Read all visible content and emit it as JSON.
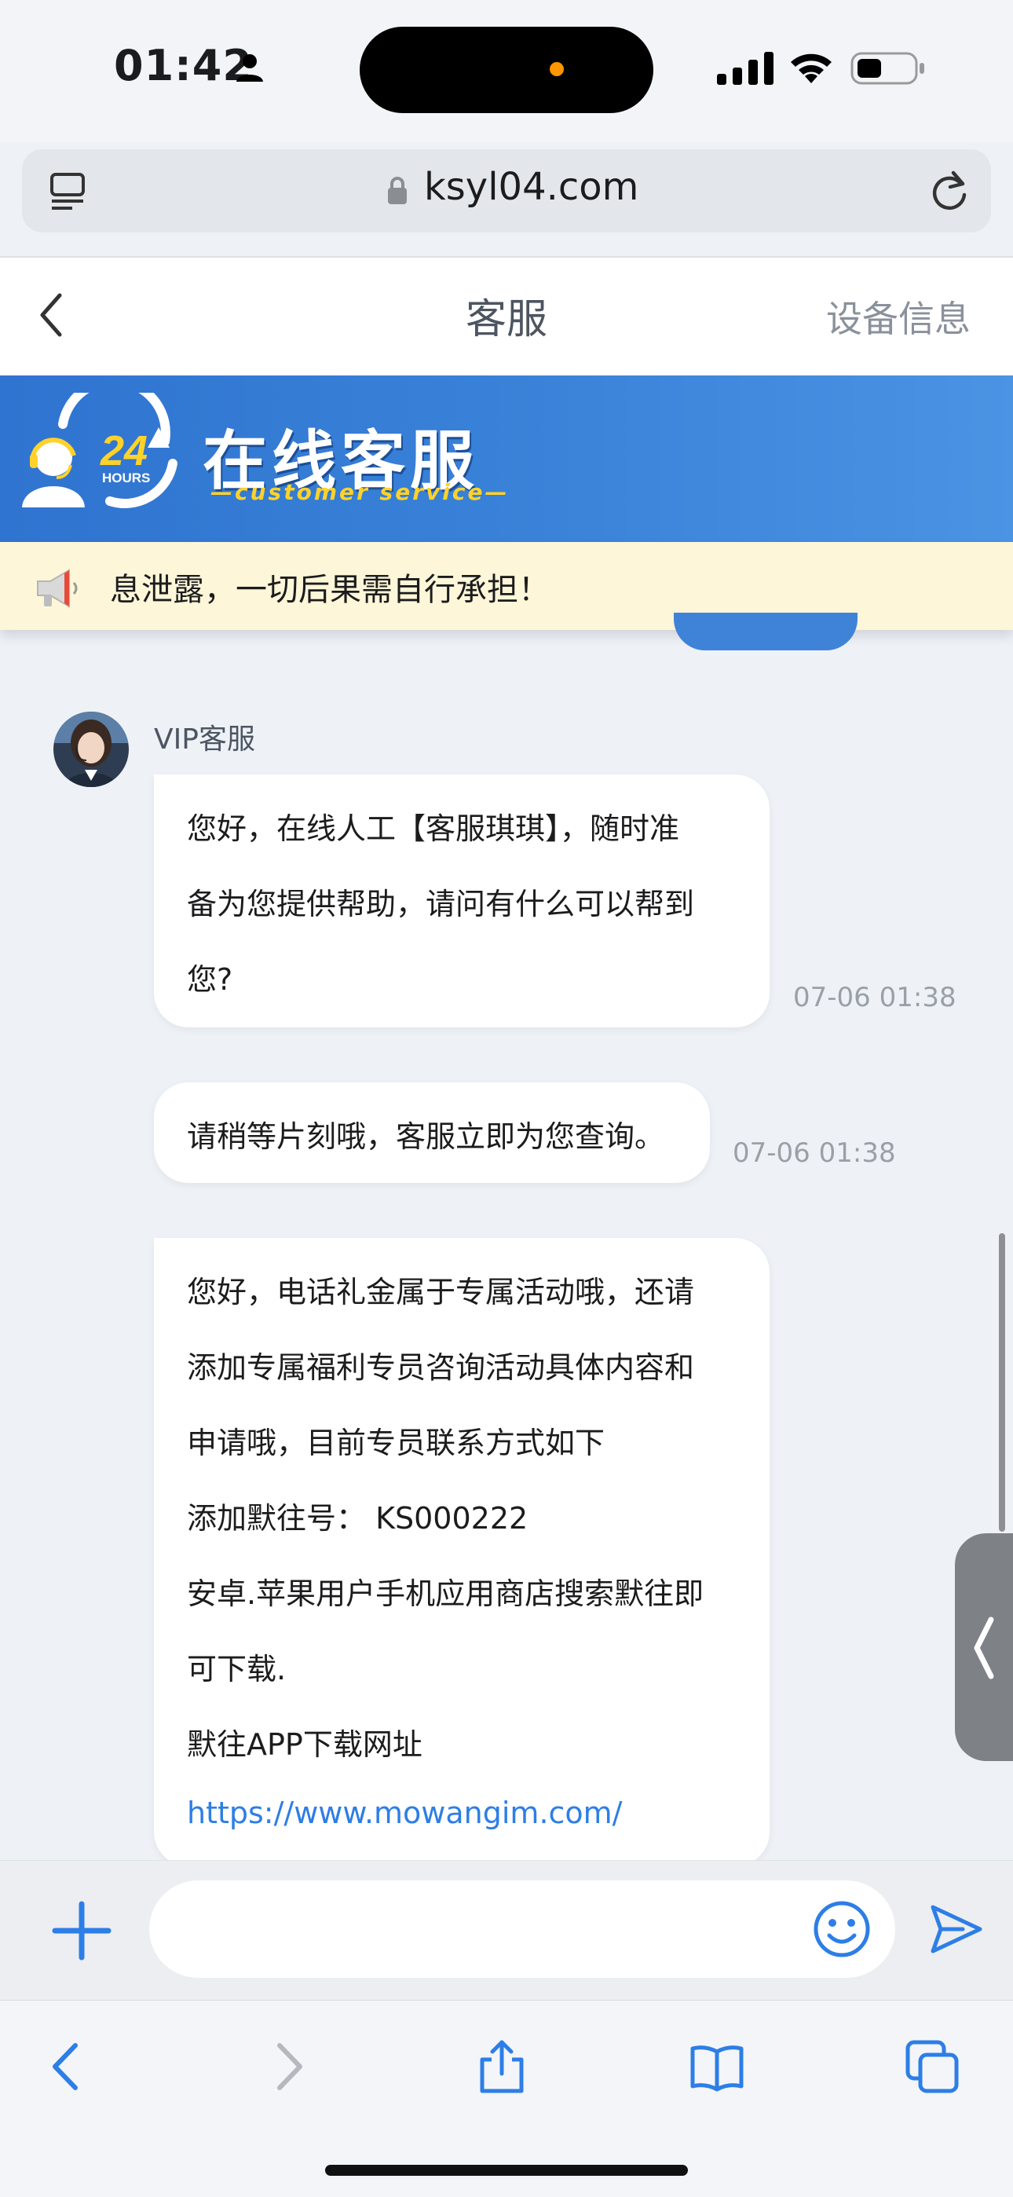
{
  "status_bar": {
    "time": "01:42",
    "accent_dot_color": "#ff9500"
  },
  "browser": {
    "url": "ksyl04.com"
  },
  "header": {
    "title": "客服",
    "right_action": "设备信息"
  },
  "banner": {
    "logo_number": "24",
    "logo_caption": "HOURS",
    "title": "在线客服",
    "subtitle": "—customer service—"
  },
  "notice": {
    "text": "息泄露，一切后果需自行承担！"
  },
  "chat": {
    "agent_name": "VIP客服",
    "messages": [
      {
        "lines": [
          "您好，在线人工【客服琪琪】，随时准",
          "备为您提供帮助，请问有什么可以帮到",
          "您?"
        ],
        "time": "07-06 01:38"
      },
      {
        "lines": [
          "请稍等片刻哦，客服立即为您查询。"
        ],
        "time": "07-06 01:38"
      },
      {
        "lines": [
          "您好，电话礼金属于专属活动哦，还请",
          "添加专属福利专员咨询活动具体内容和",
          "申请哦，目前专员联系方式如下",
          "添加默往号：   KS000222",
          "安卓.苹果用户手机应用商店搜索默往即",
          "可下载.",
          "默往APP下载网址"
        ],
        "link": "https://www.mowangim.com/"
      }
    ]
  },
  "input": {
    "placeholder": ""
  },
  "colors": {
    "accent": "#2d7ee6",
    "banner": "#3a83d9",
    "notice_bg": "#fdf6d8"
  },
  "icons": [
    "person-icon",
    "signal-icon",
    "wifi-icon",
    "battery-icon",
    "tabs-icon",
    "lock-icon",
    "reload-icon",
    "back-chevron-icon",
    "megaphone-icon",
    "plus-icon",
    "emoji-icon",
    "send-icon",
    "back-icon",
    "forward-icon",
    "share-icon",
    "bookmarks-icon",
    "tabs-overview-icon"
  ]
}
